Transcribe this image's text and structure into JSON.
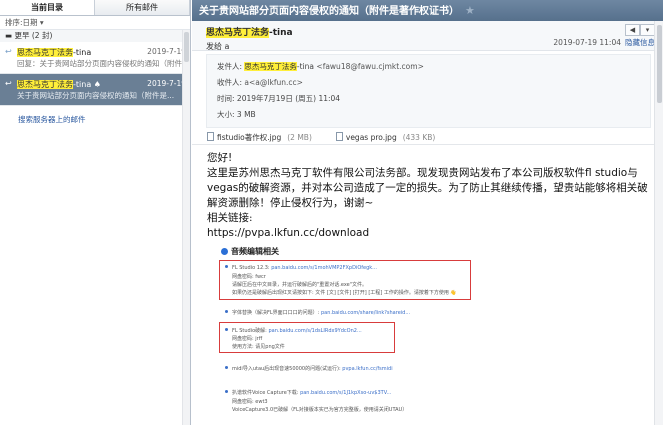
{
  "tabs": [
    "当前目录",
    "所有邮件"
  ],
  "sort_label": "排序:日期 ▾",
  "group_label": "更早 (2 封)",
  "messages": [
    {
      "sender_hl": "思杰马克丁法务",
      "sender_rest": "-tina",
      "date": "2019-7-19",
      "preview": "回复：关于贵网站部分页面内容侵权的通知（附件..."
    },
    {
      "sender_hl": "思杰马克丁法务",
      "sender_rest": "-tina ♠",
      "date": "2019-7-19",
      "preview": "关于贵网站部分页面内容侵权的通知（附件是..."
    }
  ],
  "search_server_link": "搜索服务器上的邮件",
  "email": {
    "subject": "关于贵网站部分页面内容侵权的通知（附件是著作权证书）",
    "sender_hl": "思杰马克丁法务",
    "sender_rest": "-tina",
    "sent_to": "发给 a",
    "date": "2019-07-19 11:04",
    "hide_info": "隐藏信息",
    "from_label": "发件人:",
    "from_addr": "<fawu18@fawu.cjmkt.com>",
    "to_label": "收件人:",
    "to_value": "a<a@lkfun.cc>",
    "time_label": "时间:",
    "time_value": "2019年7月19日 (周五) 11:04",
    "size_label": "大小:",
    "size_value": "3 MB",
    "attachments": [
      {
        "name": "fistudio著作权.jpg",
        "size": "(2 MB)"
      },
      {
        "name": "vegas pro.jpg",
        "size": "(433 KB)"
      }
    ],
    "body": {
      "greeting": "您好!",
      "para1": "这里是苏州思杰马克丁软件有限公司法务部。现发现贵网站发布了本公司版权软件fl studio与vegas的破解资源，并对本公司造成了一定的损失。为了防止其继续传播，望贵站能够将相关破解资源删除！停止侵权行为，谢谢~",
      "link_label": "相关链接:",
      "link_url": "https://pvpa.lkfun.cc/download"
    }
  },
  "embedded": {
    "heading": "音频编辑相关",
    "fl123_label": "FL Studio 12.3:",
    "fl123_link": "pan.baidu.com/s/1mohVMP2FXpDiOfegk...",
    "fl123_sub1": "网盘密码: fwcr",
    "fl123_sub2": "请解压后在中文目录，并运行破解后的\"重置对话.exe\"文件。",
    "fl123_sub3": "如果仍还是破解后出现红叉请按如下: 文件 [文] [文件] [打开] [工程] 工作的操作。请按着下方使用 👋",
    "font_label": "字体替换（解决FL界面口口口的问题）:",
    "font_link": "pan.baidu.com/share/link?shareid...",
    "flcrack_label": "FL Studio破解:",
    "flcrack_link": "pan.baidu.com/s/1dsLIRdx9YdcOn2...",
    "flcrack_sub1": "网盘密码: jrff",
    "flcrack_sub2": "使用方法: 请见png文件",
    "midi_label": "midi导入utau后出现音速50000的问题(试运行):",
    "midi_link": "pvpa.lkfun.cc/fsmidi",
    "vc_label": "扒谱软件Voice Capture下载:",
    "vc_link": "pan.baidu.com/s/1J1kpXso-uv$3TV...",
    "vc_sub1": "网盘密码: ewt3",
    "vc_sub2": "VoiceCapture3.0已破解（FL对接版本实已为官方完整版，使用请关闭UTAU）"
  }
}
